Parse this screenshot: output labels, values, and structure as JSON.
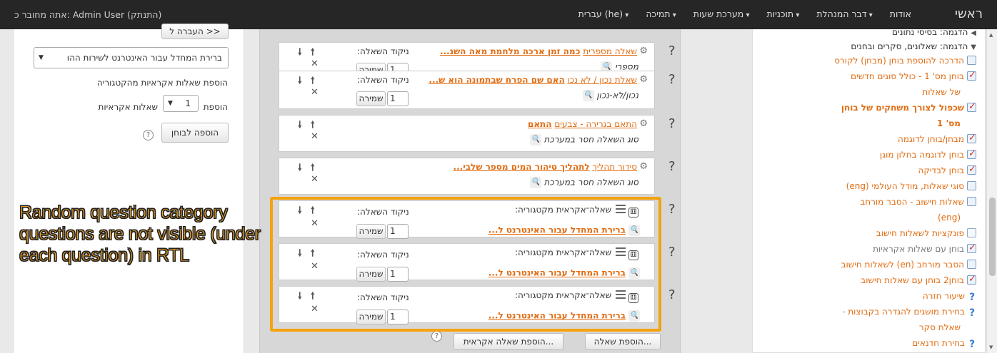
{
  "nav": {
    "brand": "ראשי",
    "items": [
      "אודות",
      "דבר המנהלת",
      "תוכניות",
      "מערכת שעות",
      "תמיכה",
      "עברית (he)"
    ],
    "user_text": "אתה מחובר כ: Admin User (התנתק)"
  },
  "tree": [
    {
      "label": "הדגמה: בסיסי נתונים",
      "kind": "folder",
      "style": "plain",
      "caret": "◀"
    },
    {
      "label": "הדגמה: שאלונים, סקרים ובחנים",
      "kind": "folder",
      "style": "plain",
      "caret": "▼"
    },
    {
      "label": "הדרכה להוספת בוחן (מבחן) לקורס",
      "kind": "quiz-doc",
      "style": "lnk"
    },
    {
      "label": "בוחן מס' 1 - כולל סוגים חדשים",
      "kind": "quiz",
      "style": "lnk"
    },
    {
      "label": "של שאלות",
      "kind": "cont",
      "style": "lnk"
    },
    {
      "label": "שכפול לצורך משחקים של בוחן",
      "kind": "quiz",
      "style": "bold"
    },
    {
      "label": "מס' 1",
      "kind": "cont",
      "style": "bold"
    },
    {
      "label": "מבחן/בוחן לדוגמה",
      "kind": "quiz",
      "style": "lnk"
    },
    {
      "label": "בוחן לדוגמה בחלון מוגן",
      "kind": "quiz",
      "style": "lnk"
    },
    {
      "label": "בוחן לבדיקה",
      "kind": "quiz",
      "style": "lnk"
    },
    {
      "label": "סוגי שאלות, מודל העולמי (eng)",
      "kind": "quiz-doc",
      "style": "lnk"
    },
    {
      "label": "שאלות חישוב - הסבר מורחב",
      "kind": "quiz-doc",
      "style": "lnk"
    },
    {
      "label": "(eng)",
      "kind": "cont",
      "style": "lnk"
    },
    {
      "label": "פונקציות לשאלות חישוב",
      "kind": "doc",
      "style": "lnk"
    },
    {
      "label": "בוחן עם שאלות אקראיות",
      "kind": "quiz",
      "style": "gray"
    },
    {
      "label": "הסבר מורחב (en) לשאלות חישוב",
      "kind": "quiz-doc",
      "style": "lnk"
    },
    {
      "label": "בוחן2 בוחן עם שאלות חישוב",
      "kind": "quiz",
      "style": "lnk"
    },
    {
      "label": "שיעור חזרה",
      "kind": "q",
      "style": "lnk"
    },
    {
      "label": "בחירת מושגים להגדרה בקבוצות -",
      "kind": "q",
      "style": "lnk"
    },
    {
      "label": "שאלת סקר",
      "kind": "cont",
      "style": "lnk"
    },
    {
      "label": "בחירת חדנאים",
      "kind": "q",
      "style": "lnk"
    }
  ],
  "left": {
    "top_button": "העברה ל >>",
    "category_select": "ברירת המחדל עבור האינטרנט לשירות ההו",
    "random_heading": "הוספת שאלות אקראיות מהקטגוריה",
    "add_prefix": "הוספת",
    "count_value": "1",
    "add_suffix": "שאלות אקראיות",
    "add_to_quiz": "הוספה לבוחן"
  },
  "slots": [
    {
      "type_link": "שאלה מספרית",
      "title": "כמה זמן ארכה מלחמת מאה השנ...",
      "sub": "מספרי",
      "sub_icon": "numeric",
      "grade_label": "ניקוד השאלה:",
      "grade": "1",
      "save": "שמירה",
      "random": false
    },
    {
      "type_link": "שאלת נכון / לא נכו",
      "title": "האם שם הפרח שבתמונה הוא ש...",
      "sub": "נכון/לא-נכון",
      "sub_icon": "truefalse",
      "grade_label": "ניקוד השאלה:",
      "grade": "1",
      "save": "שמירה",
      "random": false
    },
    {
      "type_link": "התאם בגרירה - צבעים",
      "title": "התאם",
      "sub": "סוג השאלה חסר במערכת",
      "sub_icon": "missing",
      "grade_label": "",
      "grade": "",
      "save": "",
      "random": false
    },
    {
      "type_link": "סידור תהליך",
      "title": "לתהליך טיהור המים מספר שלבי...",
      "sub": "סוג השאלה חסר במערכת",
      "sub_icon": "missing",
      "grade_label": "",
      "grade": "",
      "save": "",
      "random": false
    },
    {
      "type_link": "שאלה־אקראית מקטגוריה:",
      "title": "ברירת המחדל עבור האינטרנט ל...",
      "sub": "",
      "grade_label": "ניקוד השאלה:",
      "grade": "1",
      "save": "שמירה",
      "random": true
    },
    {
      "type_link": "שאלה־אקראית מקטגוריה:",
      "title": "ברירת המחדל עבור האינטרנט ל...",
      "sub": "",
      "grade_label": "ניקוד השאלה:",
      "grade": "1",
      "save": "שמירה",
      "random": true
    },
    {
      "type_link": "שאלה־אקראית מקטגוריה:",
      "title": "ברירת המחדל עבור האינטרנט ל...",
      "sub": "",
      "grade_label": "ניקוד השאלה:",
      "grade": "1",
      "save": "שמירה",
      "random": true
    }
  ],
  "bottom": {
    "add_question": "הוספת שאלה...",
    "add_random": "הוספת שאלה אקראית..."
  },
  "annotation": "Random question category questions are not visible (under each question) in RTL",
  "colors": {
    "link": "#e16c12",
    "highlight": "#f4a20e",
    "navbar": "#262626"
  }
}
